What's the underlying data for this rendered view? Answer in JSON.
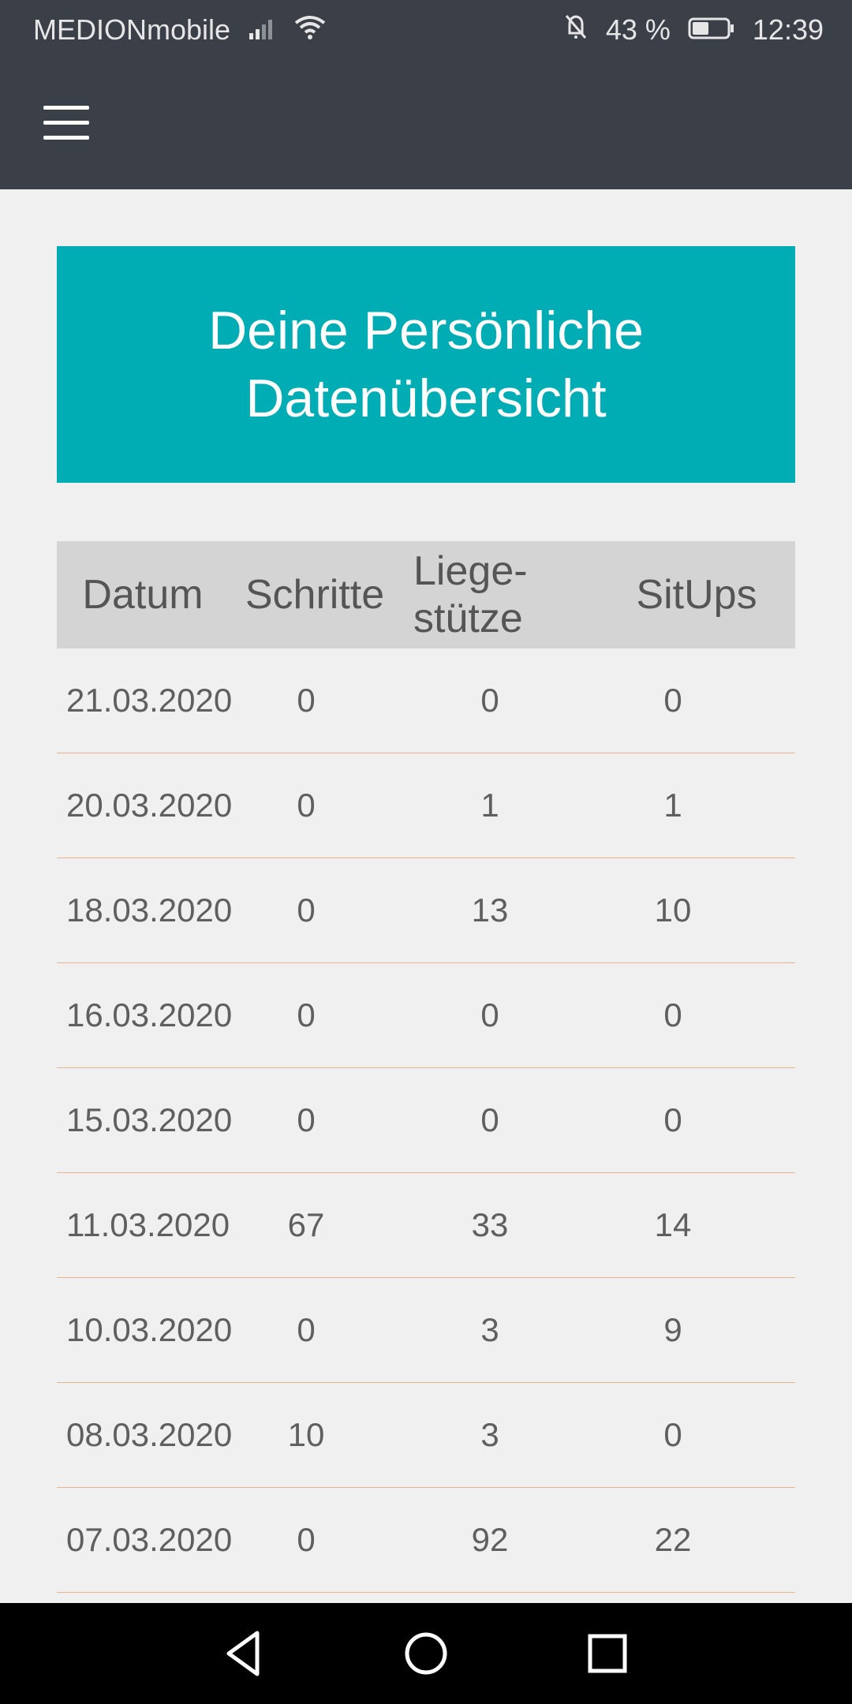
{
  "status_bar": {
    "carrier": "MEDIONmobile",
    "battery": "43 %",
    "time": "12:39"
  },
  "banner": {
    "line1": "Deine Persönliche",
    "line2": "Datenübersicht"
  },
  "table": {
    "headers": {
      "date": "Datum",
      "steps": "Schritte",
      "pushups_1": "Liege-",
      "pushups_2": "stütze",
      "situps": "SitUps"
    },
    "rows": [
      {
        "date": "21.03.2020",
        "steps": "0",
        "pushups": "0",
        "situps": "0"
      },
      {
        "date": "20.03.2020",
        "steps": "0",
        "pushups": "1",
        "situps": "1"
      },
      {
        "date": "18.03.2020",
        "steps": "0",
        "pushups": "13",
        "situps": "10"
      },
      {
        "date": "16.03.2020",
        "steps": "0",
        "pushups": "0",
        "situps": "0"
      },
      {
        "date": "15.03.2020",
        "steps": "0",
        "pushups": "0",
        "situps": "0"
      },
      {
        "date": "11.03.2020",
        "steps": "67",
        "pushups": "33",
        "situps": "14"
      },
      {
        "date": "10.03.2020",
        "steps": "0",
        "pushups": "3",
        "situps": "9"
      },
      {
        "date": "08.03.2020",
        "steps": "10",
        "pushups": "3",
        "situps": "0"
      },
      {
        "date": "07.03.2020",
        "steps": "0",
        "pushups": "92",
        "situps": "22"
      }
    ]
  },
  "icons": {
    "menu": "menu-icon",
    "back": "back-triangle-icon",
    "home": "home-circle-icon",
    "recents": "recents-square-icon"
  }
}
